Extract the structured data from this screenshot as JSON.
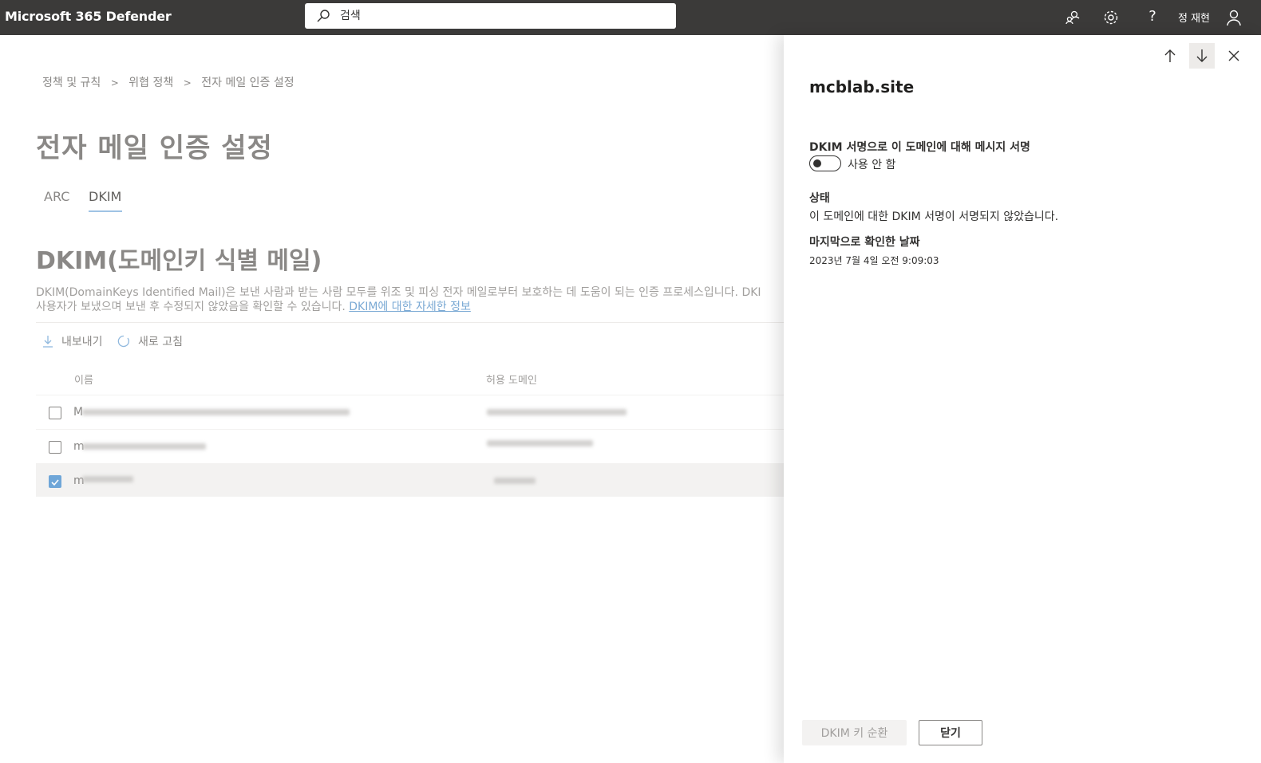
{
  "topbar": {
    "app_title": "Microsoft 365 Defender",
    "search_placeholder": "검색",
    "user_name": "정 재현",
    "icons": [
      "community-icon",
      "gear-icon",
      "help-icon",
      "user-icon"
    ],
    "bg_color": "#3b3a39"
  },
  "breadcrumb": {
    "items": [
      "정책 및 규칙",
      "위협 정책",
      "전자 메일 인증 설정"
    ],
    "separator": ">"
  },
  "page_title": "전자 메일 인증 설정",
  "tabs": [
    {
      "label": "ARC",
      "active": false
    },
    {
      "label": "DKIM",
      "active": true
    }
  ],
  "section": {
    "title": "DKIM(도메인키 식별 메일)",
    "description_line1": "DKIM(DomainKeys Identified Mail)은 보낸 사람과 받는 사람 모두를 위조 및 피싱 전자 메일로부터 보호하는 데 도움이 되는 인증 프로세스입니다. DKI",
    "description_line2": "사용자가 보냈으며 보낸 후 수정되지 않았음을 확인할 수 있습니다. ",
    "learn_more_link": "DKIM에 대한 자세한 정보"
  },
  "commands": {
    "export_label": "내보내기",
    "refresh_label": "새로 고침"
  },
  "table": {
    "columns": [
      "이름",
      "허용 도메인"
    ],
    "rows": [
      {
        "name_prefix": "M",
        "checked": false,
        "selected": false
      },
      {
        "name_prefix": "m",
        "checked": false,
        "selected": false
      },
      {
        "name_prefix": "m",
        "checked": true,
        "selected": true
      }
    ]
  },
  "panel": {
    "title": "mcblab.site",
    "dkim_sign_label": "DKIM 서명으로 이 도메인에 대해 메시지 서명",
    "toggle_state_label": "사용 안 함",
    "toggle_on": false,
    "status_label": "상태",
    "status_value": "이 도메인에 대한 DKIM 서명이 서명되지 않았습니다.",
    "last_checked_label": "마지막으로 확인한 날짜",
    "last_checked_value": "2023년 7월 4일 오전 9:09:03",
    "rotate_button": "DKIM 키 순환",
    "close_button": "닫기"
  }
}
